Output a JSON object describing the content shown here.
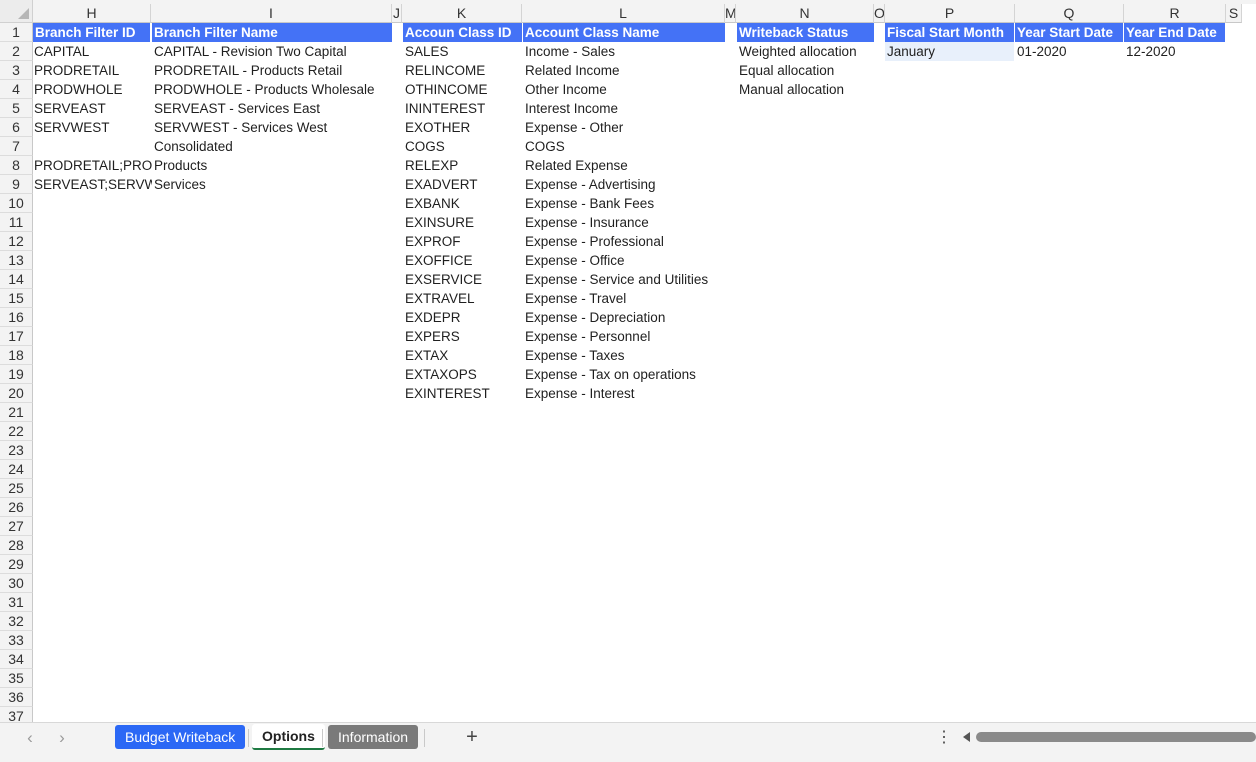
{
  "columns": [
    {
      "letter": "H",
      "w": 118
    },
    {
      "letter": "I",
      "w": 241
    },
    {
      "letter": "J",
      "w": 10
    },
    {
      "letter": "K",
      "w": 120
    },
    {
      "letter": "L",
      "w": 203
    },
    {
      "letter": "M",
      "w": 11
    },
    {
      "letter": "N",
      "w": 138
    },
    {
      "letter": "O",
      "w": 11
    },
    {
      "letter": "P",
      "w": 130
    },
    {
      "letter": "Q",
      "w": 109
    },
    {
      "letter": "R",
      "w": 102
    },
    {
      "letter": "S",
      "w": 16
    }
  ],
  "row_numbers": [
    "1",
    "2",
    "3",
    "4",
    "5",
    "6",
    "7",
    "8",
    "9",
    "10",
    "11",
    "12",
    "13",
    "14",
    "15",
    "16",
    "17",
    "18",
    "19",
    "20",
    "21",
    "22",
    "23",
    "24",
    "25",
    "26",
    "27",
    "28",
    "29",
    "30",
    "31",
    "32",
    "33",
    "34",
    "35",
    "36",
    "37"
  ],
  "branch": {
    "header_id": "Branch Filter ID",
    "header_name": "Branch Filter Name",
    "rows": [
      {
        "id": "CAPITAL",
        "name": "CAPITAL - Revision Two Capital"
      },
      {
        "id": "PRODRETAIL",
        "name": "PRODRETAIL - Products Retail"
      },
      {
        "id": "PRODWHOLE",
        "name": "PRODWHOLE - Products Wholesale"
      },
      {
        "id": "SERVEAST",
        "name": "SERVEAST - Services East"
      },
      {
        "id": "SERVWEST",
        "name": "SERVWEST - Services West"
      },
      {
        "id": "",
        "name": "Consolidated"
      },
      {
        "id": "PRODRETAIL;PRO",
        "name": "Products"
      },
      {
        "id": "SERVEAST;SERVW",
        "name": "Services"
      }
    ]
  },
  "account_class": {
    "header_id": "Accoun Class ID",
    "header_name": "Account Class Name",
    "rows": [
      {
        "id": "SALES",
        "name": "Income - Sales"
      },
      {
        "id": "RELINCOME",
        "name": "Related Income"
      },
      {
        "id": "OTHINCOME",
        "name": "Other Income"
      },
      {
        "id": "ININTEREST",
        "name": "Interest Income"
      },
      {
        "id": "EXOTHER",
        "name": "Expense - Other"
      },
      {
        "id": "COGS",
        "name": "COGS"
      },
      {
        "id": "RELEXP",
        "name": "Related Expense"
      },
      {
        "id": "EXADVERT",
        "name": "Expense - Advertising"
      },
      {
        "id": "EXBANK",
        "name": "Expense - Bank Fees"
      },
      {
        "id": "EXINSURE",
        "name": "Expense - Insurance"
      },
      {
        "id": "EXPROF",
        "name": "Expense - Professional"
      },
      {
        "id": "EXOFFICE",
        "name": "Expense - Office"
      },
      {
        "id": "EXSERVICE",
        "name": "Expense - Service and Utilities"
      },
      {
        "id": "EXTRAVEL",
        "name": "Expense - Travel"
      },
      {
        "id": "EXDEPR",
        "name": "Expense - Depreciation"
      },
      {
        "id": "EXPERS",
        "name": "Expense - Personnel"
      },
      {
        "id": "EXTAX",
        "name": "Expense - Taxes"
      },
      {
        "id": "EXTAXOPS",
        "name": "Expense - Tax on operations"
      },
      {
        "id": "EXINTEREST",
        "name": "Expense - Interest"
      }
    ]
  },
  "writeback": {
    "header": "Writeback Status",
    "rows": [
      "Weighted allocation",
      "Equal allocation",
      "Manual allocation"
    ]
  },
  "fiscal": {
    "header_month": "Fiscal Start Month",
    "header_start": "Year Start Date",
    "header_end": "Year End Date",
    "month": "January",
    "start": "01-2020",
    "end": "12-2020"
  },
  "tabs": {
    "budget_writeback": "Budget Writeback",
    "options": "Options",
    "information": "Information"
  },
  "colors": {
    "header_fill": "#4472f6",
    "selected_cell": "#e8f0fb",
    "tab_blue": "#2b68f5",
    "tab_gray": "#7a7a7a"
  }
}
